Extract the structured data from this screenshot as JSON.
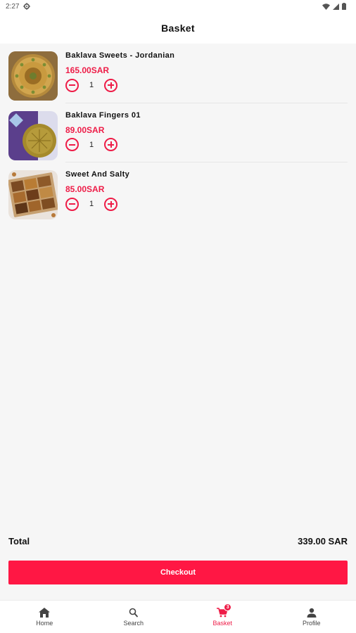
{
  "status_bar": {
    "time": "2:27",
    "settings_icon": "gear-icon",
    "wifi_icon": "wifi-icon",
    "signal_icon": "signal-icon",
    "battery_icon": "battery-icon"
  },
  "header": {
    "title": "Basket"
  },
  "items": [
    {
      "name": "Baklava Sweets - Jordanian",
      "price": "165.00SAR",
      "quantity": "1",
      "image": "round-baklava-tray"
    },
    {
      "name": "Baklava Fingers 01",
      "price": "89.00SAR",
      "quantity": "1",
      "image": "baklava-fingers-box"
    },
    {
      "name": "Sweet And Salty",
      "price": "85.00SAR",
      "quantity": "1",
      "image": "assorted-sweets-box"
    }
  ],
  "summary": {
    "total_label": "Total",
    "total_value": "339.00 SAR"
  },
  "checkout": {
    "label": "Checkout"
  },
  "nav": {
    "home": {
      "label": "Home",
      "icon": "home-icon"
    },
    "search": {
      "label": "Search",
      "icon": "search-icon"
    },
    "basket": {
      "label": "Basket",
      "icon": "cart-icon",
      "badge": "3"
    },
    "profile": {
      "label": "Profile",
      "icon": "person-icon"
    }
  },
  "colors": {
    "accent": "#ee1c47",
    "button": "#ff1744",
    "background": "#f6f6f6"
  }
}
